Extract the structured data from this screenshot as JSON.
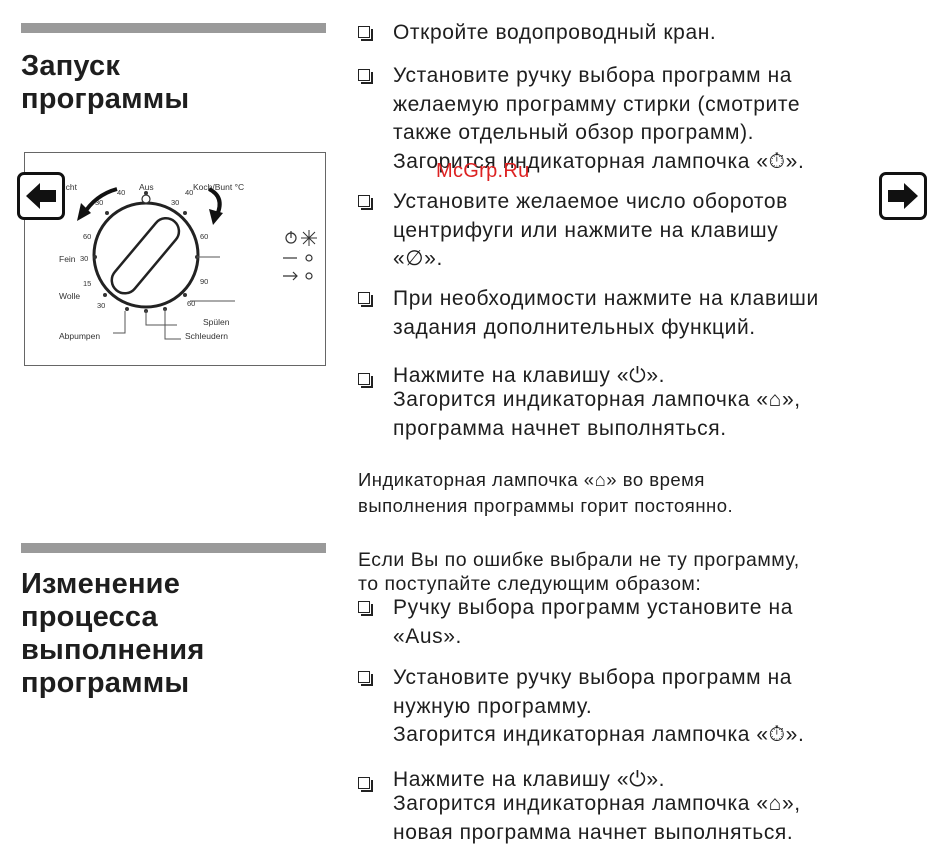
{
  "sections": [
    {
      "title_lines": [
        "Запуск",
        "программы"
      ]
    },
    {
      "title_lines": [
        "Изменение",
        "процесса",
        "выполнения",
        "программы"
      ]
    }
  ],
  "start_items": [
    {
      "lines": [
        "Откройте водопроводный кран."
      ]
    },
    {
      "lines": [
        "Установите ручку выбора программ на",
        "желаемую программу стирки (смотрите",
        "также отдельный обзор программ).",
        "Загорится индикаторная лампочка «⏱»."
      ]
    },
    {
      "lines": [
        "Установите желаемое число оборотов",
        "центрифуги или нажмите на клавишу",
        "«∅»."
      ]
    },
    {
      "lines": [
        "При необходимости нажмите на клавиши",
        "задания дополнительных функций."
      ]
    },
    {
      "lines": [
        "Нажмите на клавишу «⏻».",
        "Загорится индикаторная лампочка «⌂»,",
        "программа начнет выполняться."
      ]
    }
  ],
  "start_note": [
    "Индикаторная лампочка «⌂» во время",
    "выполнения программы горит постоянно."
  ],
  "change_intro": [
    "Если Вы по ошибке выбрали не ту программу,",
    "то поступайте следующим образом:"
  ],
  "change_items": [
    {
      "lines": [
        "Ручку выбора программ установите на",
        "«Aus»."
      ]
    },
    {
      "lines": [
        "Установите ручку выбора программ на",
        "нужную программу.",
        "Загорится индикаторная лампочка «⏱»."
      ]
    },
    {
      "lines": [
        "Нажмите на клавишу «⏻».",
        "Загорится индикаторная лампочка «⌂»,",
        "новая программа начнет выполняться."
      ]
    }
  ],
  "panel": {
    "labels": {
      "pflegeleicht": "Pflegeleicht",
      "aus": "Aus",
      "kochbunt": "Koch/Bunt °C",
      "fein": "Fein",
      "wolle": "Wolle",
      "abpumpen": "Abpumpen",
      "spuelen": "Spülen",
      "schleudern": "Schleudern"
    },
    "temps": [
      "30",
      "40",
      "60",
      "30",
      "40",
      "60",
      "90",
      "60",
      "30",
      "15",
      "30"
    ]
  },
  "watermark": "McGrp.Ru",
  "nav": {
    "prev_icon": "arrow-left-icon",
    "next_icon": "arrow-right-icon"
  }
}
